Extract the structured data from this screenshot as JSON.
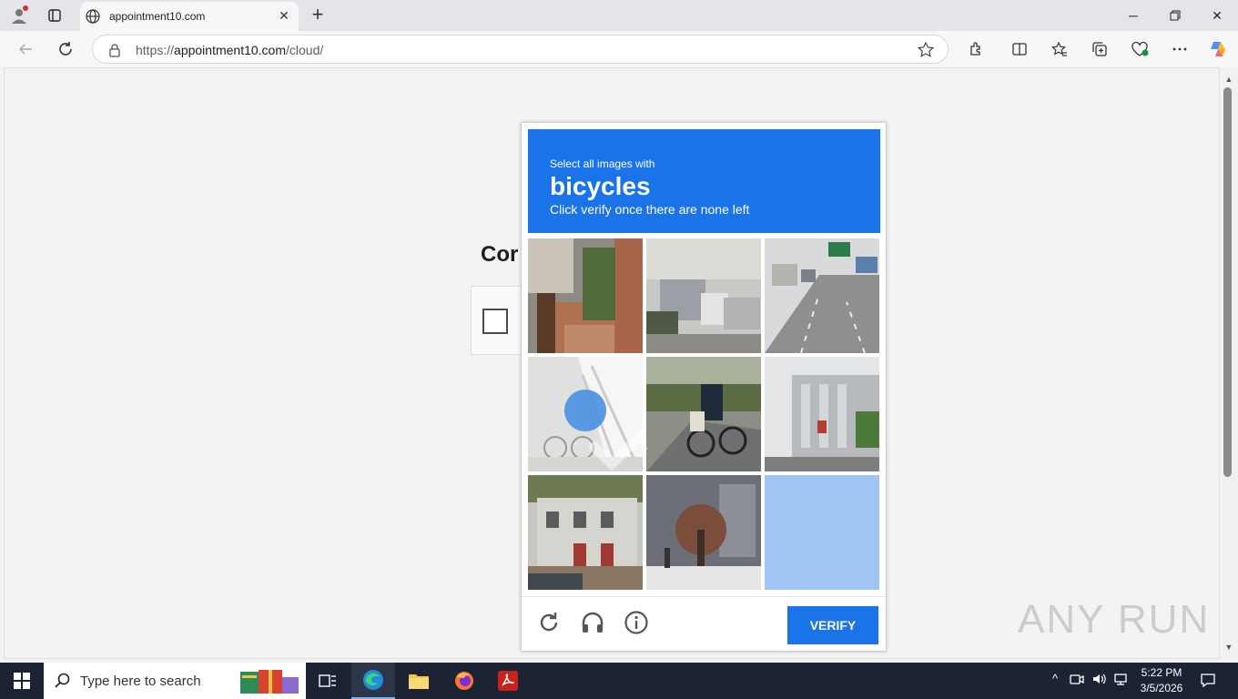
{
  "browser": {
    "tab_title": "appointment10.com",
    "url_prefix": "https://",
    "url_host": "appointment10.com",
    "url_path": "/cloud/"
  },
  "page": {
    "heading": "Cor"
  },
  "captcha": {
    "instruction": "Select all images with",
    "target": "bicycles",
    "hint": "Click verify once there are none left",
    "verify_label": "VERIFY",
    "tiles": [
      {
        "scene": "house entrance with brick wall",
        "selected": false
      },
      {
        "scene": "parked trucks and cars",
        "selected": false
      },
      {
        "scene": "highway with signs",
        "selected": false
      },
      {
        "scene": "bicycles under staircase",
        "selected": true
      },
      {
        "scene": "person riding bicycle",
        "selected": false
      },
      {
        "scene": "building facade",
        "selected": false
      },
      {
        "scene": "apartment building",
        "selected": false
      },
      {
        "scene": "street with tree",
        "selected": false
      },
      {
        "scene": "loading tile",
        "selected": false
      }
    ],
    "accent": "#1a73e8"
  },
  "watermark": "ANY RUN",
  "taskbar": {
    "search_placeholder": "Type here to search",
    "time": "5:22 PM",
    "date": "3/5/2026"
  }
}
